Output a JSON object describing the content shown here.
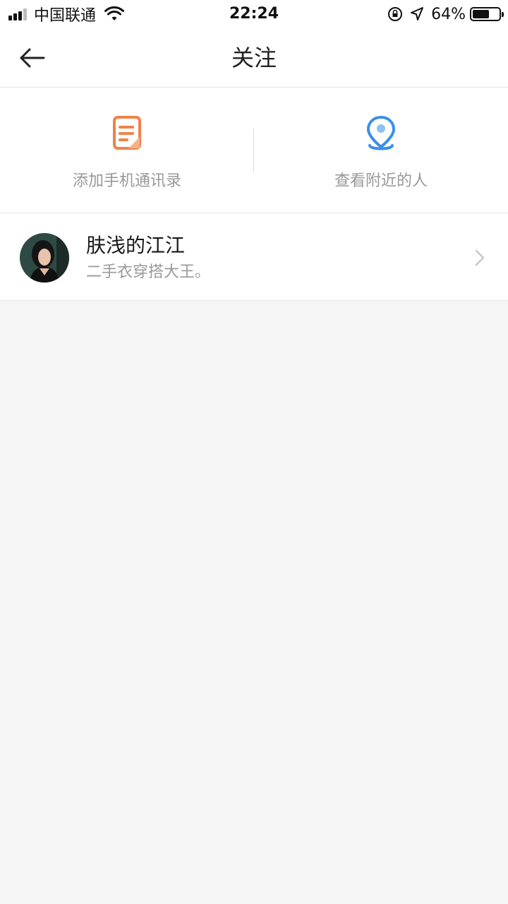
{
  "status_bar": {
    "carrier": "中国联通",
    "time": "22:24",
    "battery_percent_label": "64%",
    "battery_level": 0.64
  },
  "nav": {
    "title": "关注",
    "back_icon": "arrow-left-icon"
  },
  "quick_actions": [
    {
      "label": "添加手机通讯录",
      "icon": "contact-book-icon",
      "color": "#f0824a"
    },
    {
      "label": "查看附近的人",
      "icon": "location-pin-icon",
      "color": "#3a8fe8"
    }
  ],
  "follow_list": [
    {
      "name": "肤浅的江江",
      "description": "二手衣穿搭大王。",
      "avatar": "avatar"
    }
  ],
  "colors": {
    "background": "#f5f5f5",
    "card": "#ffffff",
    "secondary_text": "#999999",
    "divider": "#e6e6e6"
  }
}
